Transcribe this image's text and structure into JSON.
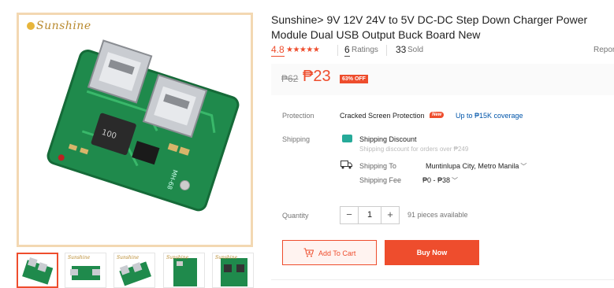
{
  "brand": "Sunshine",
  "title": "Sunshine> 9V 12V 24V to 5V DC-DC Step Down Charger Power Module Dual USB Output Buck Board New",
  "rating": {
    "score": "4.8",
    "stars": "★★★★★",
    "count": "6",
    "count_label": "Ratings",
    "sold": "33",
    "sold_label": "Sold",
    "report": "Report"
  },
  "price": {
    "original": "₱62",
    "current": "₱23",
    "discount": "63% OFF"
  },
  "protection": {
    "label": "Protection",
    "name": "Cracked Screen Protection",
    "badge": "New",
    "coverage": "Up to ₱15K coverage"
  },
  "shipping": {
    "label": "Shipping",
    "discount_title": "Shipping Discount",
    "discount_note": "Shipping discount for orders over ₱249",
    "to_label": "Shipping To",
    "to_value": "Muntinlupa City, Metro Manila",
    "fee_label": "Shipping Fee",
    "fee_value": "₱0 - ₱38"
  },
  "quantity": {
    "label": "Quantity",
    "minus": "−",
    "value": "1",
    "plus": "+",
    "available": "91 pieces available"
  },
  "actions": {
    "add_to_cart": "Add To Cart",
    "buy_now": "Buy Now"
  },
  "thumbnails": [
    "thumb-1",
    "thumb-2",
    "thumb-3",
    "thumb-4",
    "thumb-5"
  ],
  "colors": {
    "accent": "#ee4d2d",
    "pcb": "#1f8a4c",
    "link": "#0055aa"
  }
}
